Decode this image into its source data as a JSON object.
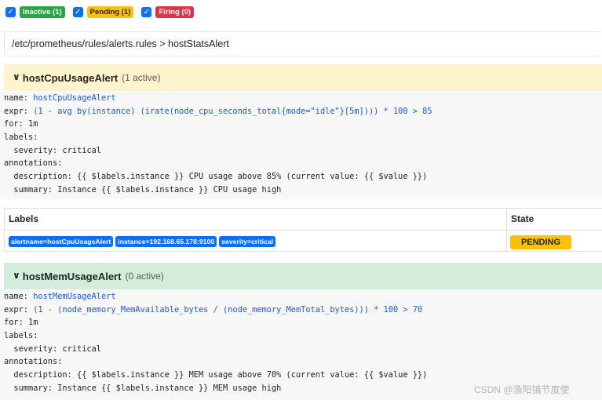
{
  "filters": [
    {
      "label": "Inactive (1)",
      "checked": true
    },
    {
      "label": "Pending (1)",
      "checked": true
    },
    {
      "label": "Firing (0)",
      "checked": true
    }
  ],
  "breadcrumb": "/etc/prometheus/rules/alerts.rules > hostStatsAlert",
  "rules": [
    {
      "name": "hostCpuUsageAlert",
      "active": "(1 active)",
      "code": {
        "name_key": "name: ",
        "name_val": "hostCpuUsageAlert",
        "expr_key": "expr: ",
        "expr_val": "(1 - avg by(instance) (irate(node_cpu_seconds_total{mode=\"idle\"}[5m]))) * 100 > 85",
        "for": "for: 1m",
        "labels": "labels:",
        "severity": "  severity: critical",
        "annotations": "annotations:",
        "description": "  description: {{ $labels.instance }} CPU usage above 85% (current value: {{ $value }})",
        "summary": "  summary: Instance {{ $labels.instance }} CPU usage high"
      }
    },
    {
      "name": "hostMemUsageAlert",
      "active": "(0 active)",
      "code": {
        "name_key": "name: ",
        "name_val": "hostMemUsageAlert",
        "expr_key": "expr: ",
        "expr_val": "(1 - (node_memory_MemAvailable_bytes / (node_memory_MemTotal_bytes))) * 100 > 70",
        "for": "for: 1m",
        "labels": "labels:",
        "severity": "  severity: critical",
        "annotations": "annotations:",
        "description": "  description: {{ $labels.instance }} MEM usage above 70% (current value: {{ $value }})",
        "summary": "  summary: Instance {{ $labels.instance }} MEM usage high"
      }
    }
  ],
  "alerts_table": {
    "headers": {
      "labels": "Labels",
      "state": "State"
    },
    "rows": [
      {
        "labels": [
          "alertname=hostCpuUsageAlert",
          "instance=192.168.65.178:9100",
          "severity=critical"
        ],
        "state": "PENDING"
      }
    ]
  },
  "watermark": "CSDN @渔阳镇节度使",
  "colors": {
    "pending_bg": "#fff3cd",
    "inactive_bg": "#d4edda",
    "label_blue": "#0d6efd",
    "pending_badge": "#ffc107"
  }
}
